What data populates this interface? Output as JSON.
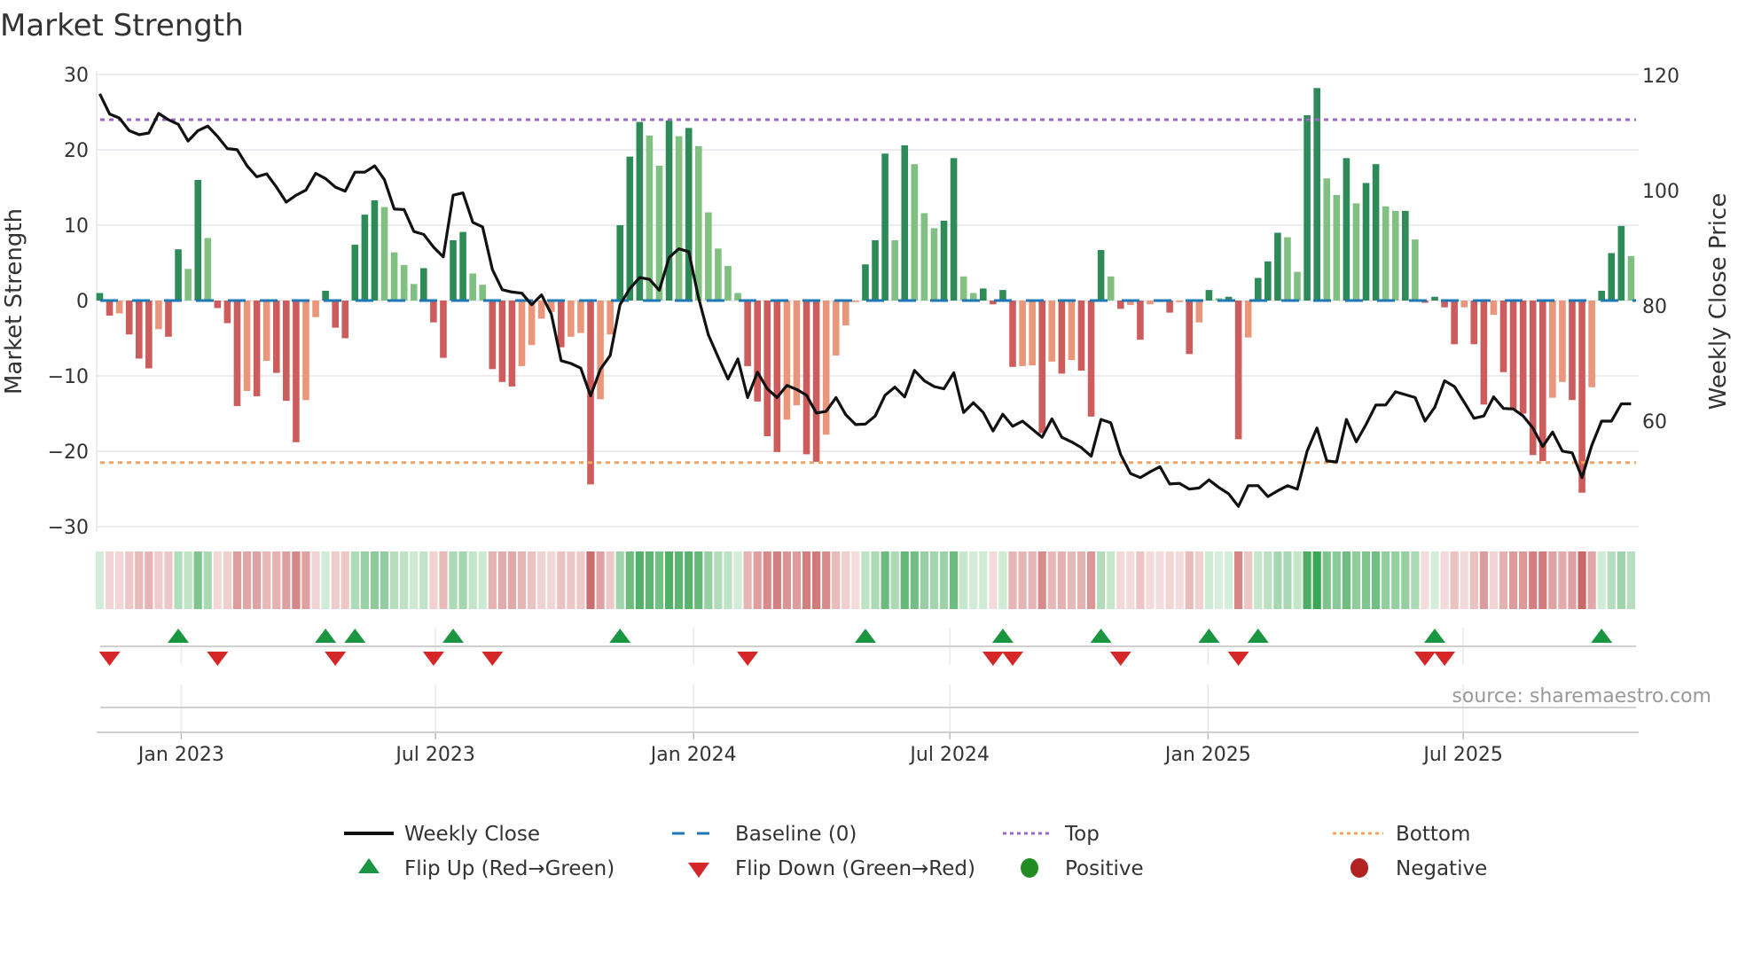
{
  "chart_data": {
    "type": "bar",
    "title": "Market Strength",
    "ylabel": "Market Strength",
    "y2label": "Weekly Close Price",
    "ylim": [
      -30,
      30
    ],
    "y2lim": [
      40,
      120
    ],
    "yticks": [
      "30",
      "20",
      "10",
      "0",
      "−10",
      "−20",
      "−30"
    ],
    "yticks_values": [
      30,
      20,
      10,
      0,
      -10,
      -20,
      -30
    ],
    "y2ticks": [
      "120",
      "100",
      "80",
      "60"
    ],
    "y2ticks_values": [
      120,
      100,
      80,
      60
    ],
    "x_unit": "week index",
    "xticks": [
      {
        "label": "Jan 2023",
        "week": 8.3
      },
      {
        "label": "Jul 2023",
        "week": 34.2
      },
      {
        "label": "Jan 2024",
        "week": 60.5
      },
      {
        "label": "Jul 2024",
        "week": 86.6
      },
      {
        "label": "Jan 2025",
        "week": 112.9
      },
      {
        "label": "Jul 2025",
        "week": 138.9
      }
    ],
    "top_level": 24,
    "bottom_level": -21.5,
    "baseline": 0,
    "strength": [
      1,
      -2,
      -1.7,
      -4.5,
      -7.7,
      -9,
      -3.8,
      -4.8,
      6.8,
      4.2,
      16,
      8.3,
      -1,
      -3,
      -14,
      -12,
      -12.7,
      -8,
      -9.6,
      -13.3,
      -18.8,
      -13.2,
      -2.2,
      1.3,
      -3.6,
      -5,
      7.4,
      11.4,
      13.3,
      12.4,
      6.4,
      4.7,
      2.2,
      4.3,
      -2.9,
      -7.6,
      8,
      9.1,
      3.6,
      2.1,
      -9.1,
      -10.8,
      -11.4,
      -8.7,
      -5.9,
      -2.4,
      -1.5,
      -6.2,
      -4.8,
      -4.3,
      -24.4,
      -13.1,
      -4.5,
      10,
      19.1,
      23.7,
      21.9,
      17.9,
      23.9,
      21.8,
      22.9,
      20.5,
      11.7,
      6.9,
      4.6,
      1,
      -8.7,
      -13.4,
      -18,
      -20.1,
      -15.8,
      -13.9,
      -20.4,
      -21.4,
      -17.8,
      -7.3,
      -3.3,
      -0.2,
      4.8,
      8,
      19.5,
      8,
      20.6,
      18.1,
      11.6,
      9.6,
      10.6,
      18.9,
      3.2,
      1,
      1.6,
      -0.5,
      1.4,
      -8.8,
      -8.7,
      -8.6,
      -17.6,
      -8.1,
      -9.7,
      -7.9,
      -9.3,
      -15.4,
      6.7,
      3.2,
      -1.1,
      -0.6,
      -5.2,
      -0.5,
      -0.2,
      -1.6,
      -0.2,
      -7.1,
      -2.9,
      1.4,
      0.3,
      0.5,
      -18.4,
      -4.9,
      3,
      5.2,
      9,
      8.4,
      3.8,
      24.6,
      28.2,
      16.2,
      14,
      18.9,
      12.9,
      15.6,
      18.1,
      12.5,
      11.9,
      11.9,
      8.1,
      -0.3,
      0.5,
      -0.9,
      -5.8,
      -0.9,
      -5.8,
      -13.8,
      -1.9,
      -9.5,
      -14.4,
      -15,
      -20.5,
      -21.3,
      -12.9,
      -10.8,
      -13.2,
      -25.5,
      -11.5,
      1.3,
      6.3,
      9.9,
      5.9
    ],
    "weekly_close": [
      116.8,
      113.3,
      112.6,
      110.4,
      109.7,
      110,
      113.4,
      112.3,
      111.5,
      108.6,
      110.4,
      111.2,
      109.4,
      107.3,
      107.1,
      104.3,
      102.4,
      102.9,
      100.6,
      98,
      99.2,
      100.1,
      103,
      102.1,
      100.6,
      99.9,
      103.2,
      103.2,
      104.3,
      101.9,
      96.8,
      96.7,
      92.9,
      92.4,
      90.2,
      88.5,
      99.2,
      99.6,
      94.5,
      93.7,
      86.3,
      82.8,
      82.4,
      82.2,
      80.2,
      81.9,
      78.6,
      70.5,
      70,
      69.2,
      64.4,
      69,
      71.4,
      80.2,
      83,
      84.9,
      84.6,
      82.7,
      88.4,
      89.9,
      89.4,
      81.4,
      75,
      71.1,
      67.3,
      70.8,
      64.1,
      68.5,
      65.6,
      64.1,
      66.2,
      65.5,
      64.5,
      61.4,
      61.7,
      64.1,
      61.1,
      59.4,
      59.5,
      60.9,
      64.5,
      65.9,
      64.2,
      68.8,
      67,
      66,
      65.6,
      68.4,
      61.5,
      63.2,
      61.5,
      58.3,
      61.2,
      59.1,
      60,
      58.6,
      57.2,
      60.4,
      57.2,
      56.4,
      55.4,
      53.9,
      60.3,
      59.7,
      54.2,
      50.9,
      50.2,
      51.2,
      52.1,
      49.1,
      49.2,
      48.2,
      48.4,
      49.8,
      48.5,
      47.4,
      45.2,
      48.8,
      48.8,
      46.9,
      47.9,
      48.8,
      48.2,
      54.8,
      58.8,
      53.1,
      52.9,
      60.3,
      56.4,
      59.4,
      62.8,
      62.8,
      65.1,
      64.6,
      64.1,
      60,
      62.4,
      67,
      66,
      63.3,
      60.5,
      60.9,
      64.2,
      62.2,
      62.1,
      60.9,
      58.8,
      55.6,
      58.1,
      54.8,
      54.5,
      50.2,
      55.8,
      60,
      60,
      63,
      63
    ],
    "flip_up_weeks": [
      8,
      23,
      26,
      36,
      53,
      78,
      92,
      102,
      113,
      118,
      136,
      153
    ],
    "flip_down_weeks": [
      1,
      12,
      24,
      34,
      40,
      66,
      91,
      93,
      104,
      116,
      135,
      137
    ],
    "legend": {
      "placement": "bottom",
      "items": [
        {
          "label": "Weekly Close",
          "symbol": "line-solid"
        },
        {
          "label": "Baseline (0)",
          "symbol": "line-dashed"
        },
        {
          "label": "Top",
          "symbol": "line-dotted"
        },
        {
          "label": "Bottom",
          "symbol": "line-dotted"
        },
        {
          "label": "Flip Up (Red→Green)",
          "symbol": "triangle-up"
        },
        {
          "label": "Flip Down (Green→Red)",
          "symbol": "triangle-down"
        },
        {
          "label": "Positive",
          "symbol": "circle"
        },
        {
          "label": "Negative",
          "symbol": "circle"
        }
      ]
    },
    "source": "source: sharemaestro.com"
  },
  "colors": {
    "pos_strong": "#2e8b57",
    "pos_weak": "#80c080",
    "neg_strong": "#cd5c5c",
    "neg_weak": "#e9967a",
    "close": "#111111",
    "baseline": "#1f77b4",
    "top": "#9966cc",
    "bottom": "#f4a460",
    "flip_up": "#1a9641",
    "flip_down": "#d62728",
    "positive": "#228b22",
    "negative": "#b22222"
  }
}
